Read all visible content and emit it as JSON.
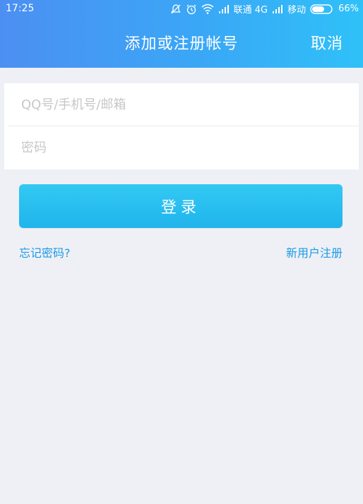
{
  "status_bar": {
    "time": "17:25",
    "carrier1": "联通 4G",
    "carrier2": "移动",
    "battery": "66%",
    "battery_level": 0.66
  },
  "header": {
    "title": "添加或注册帐号",
    "cancel_label": "取消"
  },
  "form": {
    "account_placeholder": "QQ号/手机号/邮箱",
    "account_value": "",
    "password_placeholder": "密码",
    "password_value": ""
  },
  "login_label": "登录",
  "links": {
    "forgot": "忘记密码?",
    "register": "新用户注册"
  },
  "colors": {
    "header_start": "#4c8ff2",
    "header_end": "#2fc1f8",
    "button": "#20b4ec",
    "link": "#1a9be6",
    "background": "#eff0f5"
  }
}
